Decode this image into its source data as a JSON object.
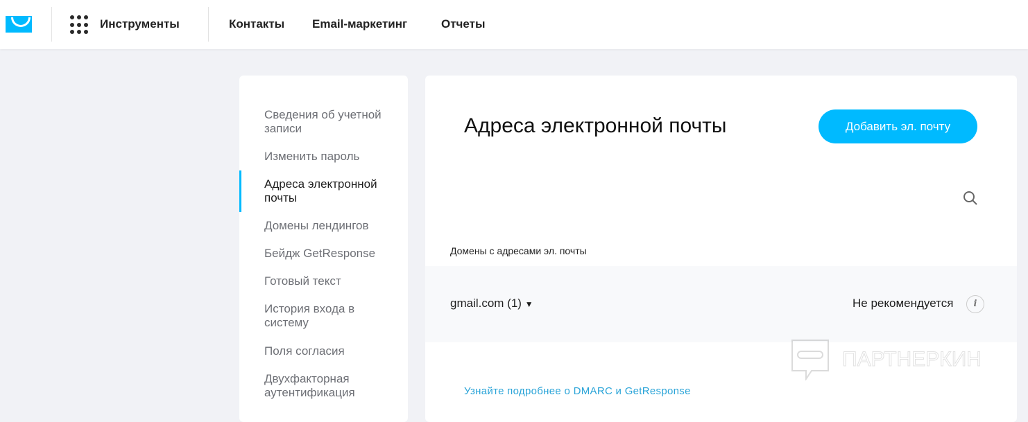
{
  "header": {
    "tools": "Инструменты",
    "nav": [
      "Контакты",
      "Email-маркетинг",
      "Отчеты"
    ]
  },
  "sidebar": {
    "items": [
      "Сведения об учетной записи",
      "Изменить пароль",
      "Адреса электронной почты",
      "Домены лендингов",
      "Бейдж GetResponse",
      "Готовый текст",
      "История входа в систему",
      "Поля согласия",
      "Двухфакторная аутентификация"
    ],
    "active": 2
  },
  "main": {
    "title": "Адреса электронной почты",
    "add_button": "Добавить эл. почту",
    "section_label": "Домены с адресами эл. почты",
    "domain": "gmail.com (1)",
    "status": "Не рекомендуется",
    "info": "i",
    "link": "Узнайте подробнее о DMARC и GetResponse"
  },
  "watermark": "ПАРТНЕРКИН"
}
